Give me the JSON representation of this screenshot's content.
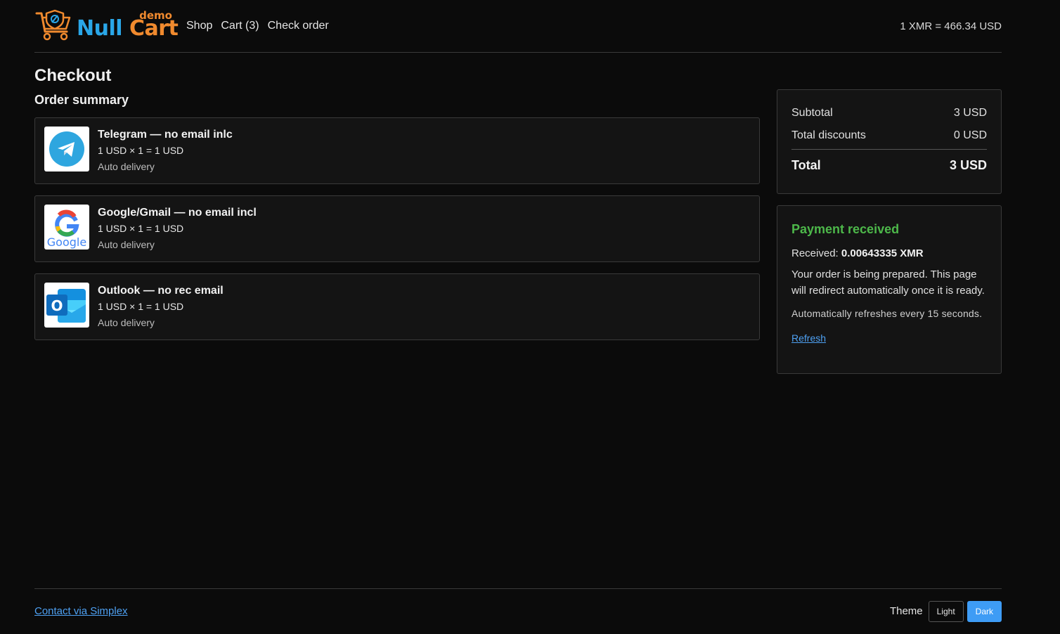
{
  "brand": {
    "null": "Null",
    "cart": "Cart",
    "demo": "demo"
  },
  "nav": {
    "shop": "Shop",
    "cart": "Cart (3)",
    "check_order": "Check order"
  },
  "rate": "1 XMR = 466.34 USD",
  "page_title": "Checkout",
  "order_summary_title": "Order summary",
  "items": [
    {
      "name": "Telegram — no email inlc",
      "price_line": "1 USD × 1 = 1 USD",
      "delivery": "Auto delivery",
      "icon": "telegram-icon"
    },
    {
      "name": "Google/Gmail — no email incl",
      "price_line": "1 USD × 1 = 1 USD",
      "delivery": "Auto delivery",
      "icon": "google-icon"
    },
    {
      "name": "Outlook — no rec email",
      "price_line": "1 USD × 1 = 1 USD",
      "delivery": "Auto delivery",
      "icon": "outlook-icon"
    }
  ],
  "summary": {
    "subtotal_label": "Subtotal",
    "subtotal_value": "3 USD",
    "discounts_label": "Total discounts",
    "discounts_value": "0 USD",
    "total_label": "Total",
    "total_value": "3 USD"
  },
  "payment": {
    "title": "Payment received",
    "received_label": "Received:",
    "received_value": "0.00643335 XMR",
    "message": "Your order is being prepared. This page will redirect automatically once it is ready.",
    "auto_refresh": "Automatically refreshes every 15 seconds.",
    "refresh_link": "Refresh"
  },
  "footer": {
    "contact_link": "Contact via Simplex",
    "theme_label": "Theme",
    "theme_light": "Light",
    "theme_dark": "Dark",
    "theme_selected": "Dark"
  },
  "colors": {
    "background": "#0b0b0b",
    "brand_blue": "#2aa7e8",
    "brand_orange": "#f08a2e",
    "success": "#4db84a",
    "link": "#4ea1f3",
    "accent_button": "#3e9cf5"
  }
}
